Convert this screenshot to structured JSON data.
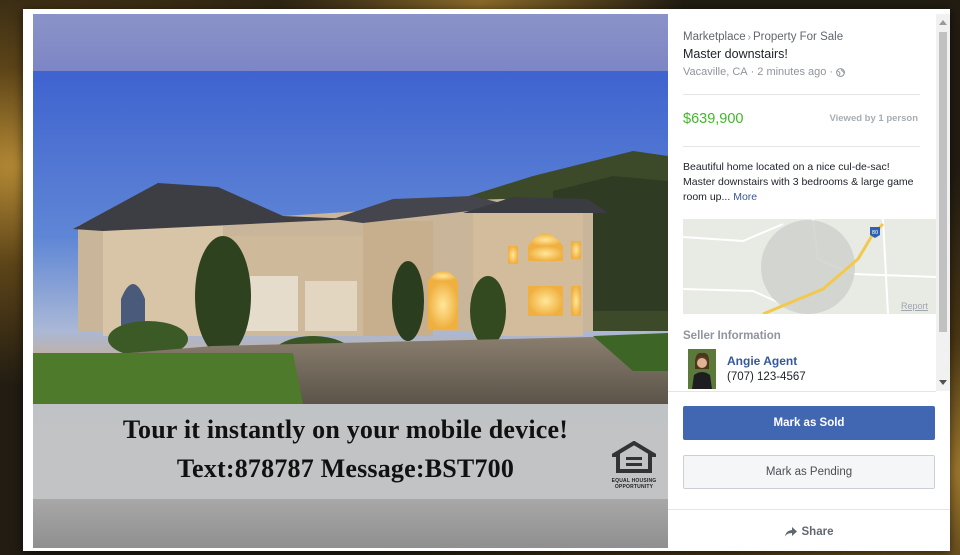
{
  "listing": {
    "breadcrumb": [
      "Marketplace",
      "Property For Sale"
    ],
    "title": "Master downstairs!",
    "location": "Vacaville, CA",
    "posted": "2 minutes ago",
    "price": "$639,900",
    "viewed": "Viewed by 1 person",
    "description": "Beautiful home located on a nice cul-de-sac! Master downstairs with 3 bedrooms & large game room up...",
    "more_label": "More",
    "map_report": "Report",
    "map_highway": "80"
  },
  "photo": {
    "banner_line1": "Tour it instantly on your mobile device!",
    "banner_line2": "Text:878787 Message:BST700",
    "eho_line1": "EQUAL HOUSING",
    "eho_line2": "OPPORTUNITY"
  },
  "seller": {
    "heading": "Seller Information",
    "name": "Angie Agent",
    "phone": "(707) 123-4567"
  },
  "actions": {
    "mark_sold": "Mark as Sold",
    "mark_pending": "Mark as Pending",
    "share": "Share"
  },
  "icons": {
    "globe": "globe-icon",
    "share": "share-arrow-icon",
    "eho": "equal-housing-icon"
  },
  "colors": {
    "price": "#42b72a",
    "primary_button": "#4267b2",
    "link": "#365899"
  }
}
